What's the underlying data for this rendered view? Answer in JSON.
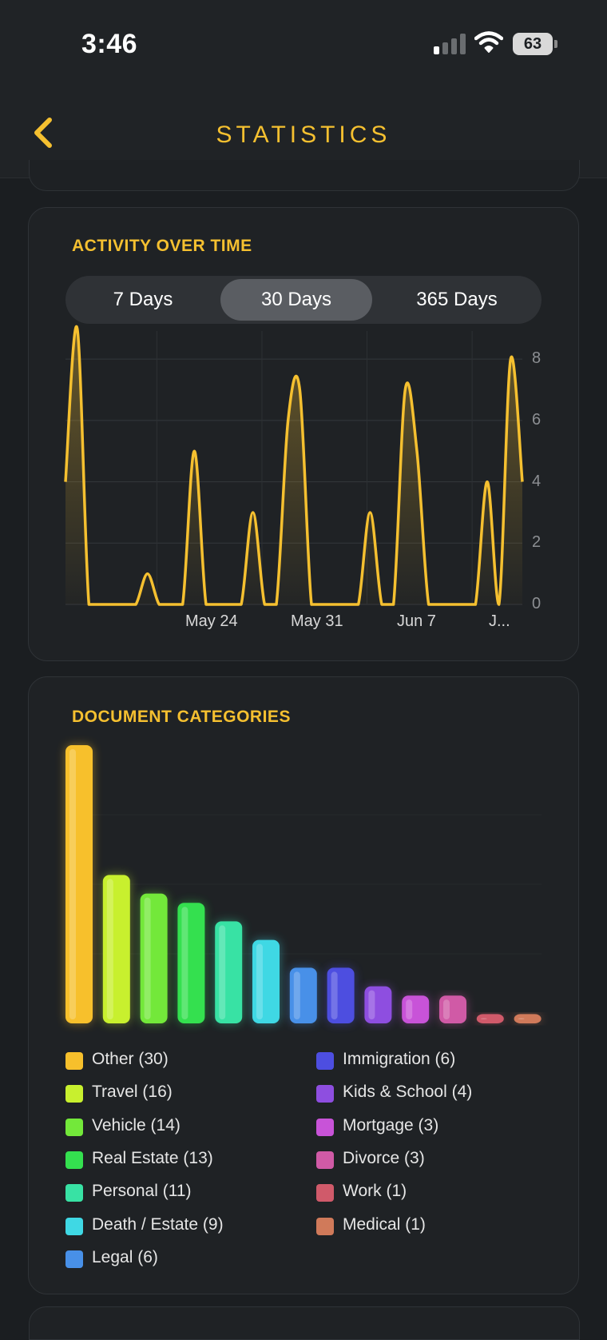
{
  "status_bar": {
    "time": "3:46",
    "battery": "63"
  },
  "nav": {
    "title": "STATISTICS",
    "back_icon": "chevron-left-icon"
  },
  "activity": {
    "title": "ACTIVITY OVER TIME",
    "tabs": [
      {
        "label": "7 Days",
        "selected": false
      },
      {
        "label": "30 Days",
        "selected": true
      },
      {
        "label": "365 Days",
        "selected": false
      }
    ]
  },
  "categories_card": {
    "title": "DOCUMENT CATEGORIES"
  },
  "colors": {
    "accent": "#f5c030",
    "card_bg": "#1f2225",
    "page_bg": "#1b1e21"
  },
  "chart_data": [
    {
      "type": "area",
      "x_tick_labels": [
        "May 24",
        "May 31",
        "Jun 7",
        "J..."
      ],
      "y_ticks": [
        0,
        2,
        4,
        6,
        8
      ],
      "ylim": [
        0,
        8.5
      ],
      "values": [
        4,
        9,
        0,
        0,
        0,
        0,
        0,
        1,
        0,
        0,
        0,
        5,
        0,
        0,
        0,
        0,
        3,
        0,
        0,
        6,
        7,
        0,
        0,
        0,
        0,
        0,
        3,
        0,
        0,
        7,
        5,
        0,
        0,
        0,
        0,
        0,
        4,
        0,
        8,
        4
      ],
      "line_color": "#f5c030",
      "grid": true
    },
    {
      "type": "bar",
      "categories": [
        "Other",
        "Travel",
        "Vehicle",
        "Real Estate",
        "Personal",
        "Death / Estate",
        "Legal",
        "Immigration",
        "Kids & School",
        "Mortgage",
        "Divorce",
        "Work",
        "Medical"
      ],
      "values": [
        30,
        16,
        14,
        13,
        11,
        9,
        6,
        6,
        4,
        3,
        3,
        1,
        1
      ],
      "colors": [
        "#f7c02c",
        "#c8f02e",
        "#73e83a",
        "#34e04f",
        "#38e2a4",
        "#3fd8e4",
        "#4890e8",
        "#4d4ee0",
        "#8e4ee0",
        "#c853d8",
        "#d05aa6",
        "#d05a6a",
        "#d07a5a"
      ],
      "legend": [
        "Other (30)",
        "Travel (16)",
        "Vehicle (14)",
        "Real Estate (13)",
        "Personal (11)",
        "Death / Estate (9)",
        "Legal (6)",
        "Immigration (6)",
        "Kids & School (4)",
        "Mortgage (3)",
        "Divorce (3)",
        "Work (1)",
        "Medical (1)"
      ]
    }
  ]
}
